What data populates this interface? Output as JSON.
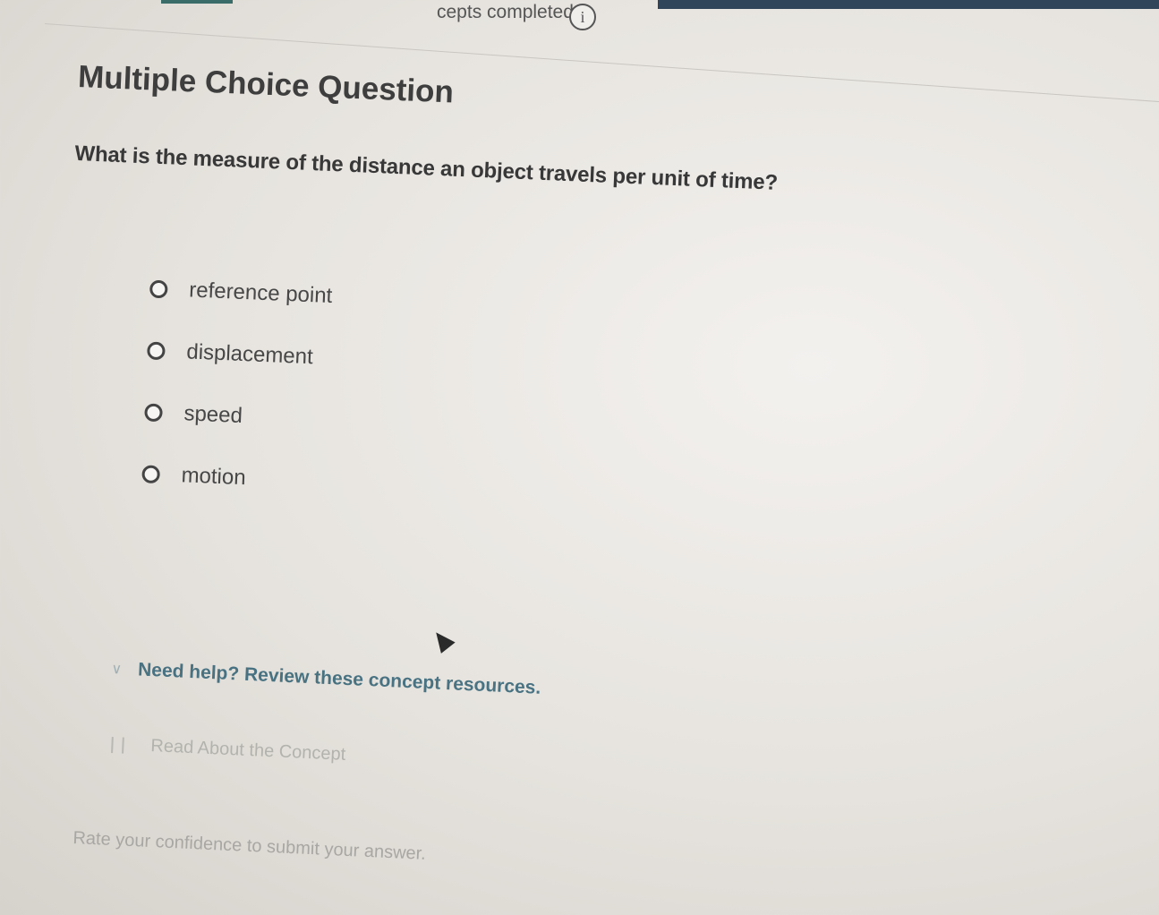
{
  "header": {
    "concepts_status": "cepts completed",
    "info_glyph": "i"
  },
  "question_card": {
    "title": "Multiple Choice Question",
    "question": "What is the measure of the distance an object travels per unit of time?",
    "options": [
      {
        "label": "reference point",
        "selected": false
      },
      {
        "label": "displacement",
        "selected": false
      },
      {
        "label": "speed",
        "selected": false
      },
      {
        "label": "motion",
        "selected": false
      }
    ]
  },
  "help": {
    "toggle_text": "Need help? Review these concept resources.",
    "resource_link": "Read About the Concept"
  },
  "footer": {
    "rate_prompt": "Rate your confidence to submit your answer."
  },
  "colors": {
    "accent_bar": "#30445a",
    "help_link": "#2e5f72"
  },
  "icons": {
    "info": "info-icon",
    "chevron": "chevron-down-icon",
    "book": "book-icon",
    "cursor": "mouse-pointer-icon"
  }
}
